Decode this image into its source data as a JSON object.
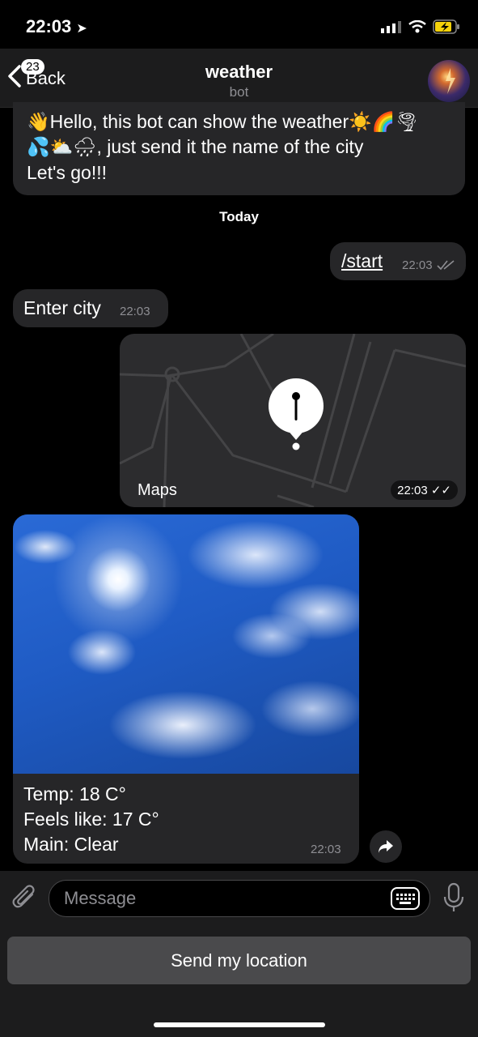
{
  "status_bar": {
    "time": "22:03"
  },
  "header": {
    "back_label": "Back",
    "unread_count": "23",
    "title": "weather",
    "subtitle": "bot"
  },
  "messages": {
    "welcome": {
      "line1": "👋Hello, this bot can show the weather☀️🌈🌪",
      "line2": "💦⛅🌧, just send it the name of the city",
      "line3": "Let's go!!!"
    },
    "date_separator": "Today",
    "start_cmd": {
      "text": "/start",
      "time": "22:03"
    },
    "enter_city": {
      "text": "Enter city",
      "time": "22:03"
    },
    "location": {
      "maps_label": "Maps",
      "time": "22:03"
    },
    "weather": {
      "temp": "Temp: 18 C°",
      "feels_like": "Feels like: 17 C°",
      "main": "Main: Clear",
      "time": "22:03"
    }
  },
  "input": {
    "placeholder": "Message"
  },
  "keyboard": {
    "send_location": "Send my location"
  },
  "colors": {
    "background": "#000000",
    "bubble": "#262628",
    "accent": "#ffffff",
    "sky": "#1f5bc4"
  }
}
